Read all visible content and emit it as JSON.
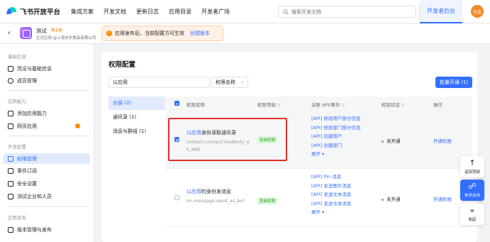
{
  "topnav": {
    "logo_text": "飞书开放平台",
    "links": [
      "集成方案",
      "开发文档",
      "更新日志",
      "应用目录",
      "开发者广场"
    ],
    "search_placeholder": "搜索开发文档",
    "dev_tab": "开发者后台",
    "avatar_text": "社会"
  },
  "app": {
    "name": "测试",
    "badge": "待上线",
    "subtitle": "正式应用 @上海东乐食品有限公司"
  },
  "notice": {
    "text": "应用发布后，当前配置方可生效",
    "link": "创建版本"
  },
  "sidebar": {
    "groups": [
      "基础信息",
      "应用能力",
      "开发配置",
      "应用发布"
    ],
    "items": [
      {
        "label": "凭证与基础信息"
      },
      {
        "label": "成员管理"
      },
      {
        "label": "添加应用能力"
      },
      {
        "label": "网页应用"
      },
      {
        "label": "权限管理"
      },
      {
        "label": "事件订阅"
      },
      {
        "label": "安全设置"
      },
      {
        "label": "测试企业和人员"
      },
      {
        "label": "版本管理与发布"
      }
    ]
  },
  "main": {
    "title": "权限配置",
    "filter_value": "以应用",
    "filter_select": "权限名称",
    "batch_button": "批量开通 (1)",
    "categories": [
      "全部 (2)",
      "通讯录 (1)",
      "消息与群组 (1)"
    ],
    "columns": [
      "权限名称",
      "权限等级",
      "关联 API/事件",
      "权限状态",
      "操作"
    ],
    "rows": [
      {
        "name_link": "以应用",
        "name_rest": "身份读取通讯录",
        "code": "contact:contact:readonly_as_app",
        "level": "免审权限",
        "apis": [
          "[API] 修改用户部分信息",
          "[API] 修改部门部分信息",
          "[API] 创建用户",
          "[API] 创建部门"
        ],
        "more": "展开 ▾",
        "status": "未开通",
        "op": "开通权限"
      },
      {
        "name_link": "以应用",
        "name_rest": "的身份发消息",
        "code": "im:message:send_as_bot",
        "level": "免审权限",
        "apis": [
          "[API] Pin 消息",
          "[API] 发送图片消息",
          "[API] 发送文本消息",
          "[API] 发送文本消息"
        ],
        "more": "展开 ▾",
        "status": "未开通",
        "op": "开通权限"
      }
    ]
  },
  "float_tools": [
    "返回顶部",
    "技术支持",
    "收起"
  ]
}
